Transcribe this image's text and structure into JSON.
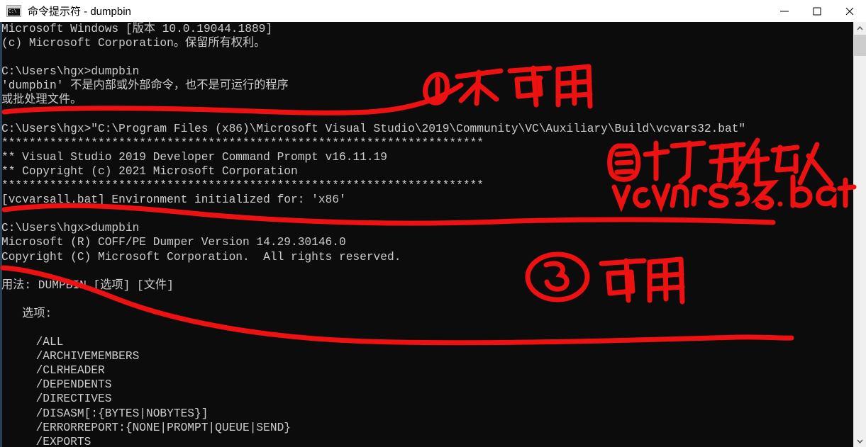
{
  "window": {
    "title": "命令提示符 - dumpbin",
    "icon": "cmd-console-icon",
    "icon_text": "C:\\",
    "controls": {
      "minimize": "minimize-button",
      "maximize": "maximize-button",
      "close": "close-button"
    }
  },
  "colors": {
    "titlebar_bg": "#ffffff",
    "console_bg": "#0c0c0c",
    "console_fg": "#cccccc",
    "annotation_red": "#ee1111",
    "scrollbar_track": "#f0f0f0",
    "scrollbar_thumb": "#cdcdcd"
  },
  "console": {
    "lines": [
      "Microsoft Windows [版本 10.0.19044.1889]",
      "(c) Microsoft Corporation。保留所有权利。",
      "",
      "C:\\Users\\hgx>dumpbin",
      "'dumpbin' 不是内部或外部命令，也不是可运行的程序",
      "或批处理文件。",
      "",
      "C:\\Users\\hgx>\"C:\\Program Files (x86)\\Microsoft Visual Studio\\2019\\Community\\VC\\Auxiliary\\Build\\vcvars32.bat\"",
      "**********************************************************************",
      "** Visual Studio 2019 Developer Command Prompt v16.11.19",
      "** Copyright (c) 2021 Microsoft Corporation",
      "**********************************************************************",
      "[vcvarsall.bat] Environment initialized for: 'x86'",
      "",
      "C:\\Users\\hgx>dumpbin",
      "Microsoft (R) COFF/PE Dumper Version 14.29.30146.0",
      "Copyright (C) Microsoft Corporation.  All rights reserved.",
      "",
      "用法: DUMPBIN [选项] [文件]",
      "",
      "   选项:",
      "",
      "     /ALL",
      "     /ARCHIVEMEMBERS",
      "     /CLRHEADER",
      "     /DEPENDENTS",
      "     /DIRECTIVES",
      "     /DISASM[:{BYTES|NOBYTES}]",
      "     /ERRORREPORT:{NONE|PROMPT|QUEUE|SEND}",
      "     /EXPORTS"
    ]
  },
  "scrollbar": {
    "up_arrow": "scroll-up-arrow-icon",
    "down_arrow": "scroll-down-arrow-icon",
    "thumb": "scrollbar-thumb"
  },
  "annotations": [
    {
      "id": "annotation-1",
      "label": "①不可用",
      "meaning": "not usable"
    },
    {
      "id": "annotation-2",
      "label": "②打开/拖入",
      "sublabel": "vcvars32.bat",
      "meaning": "open / drag in vcvars32.bat"
    },
    {
      "id": "annotation-3",
      "label": "③ 可用",
      "meaning": "usable"
    }
  ]
}
